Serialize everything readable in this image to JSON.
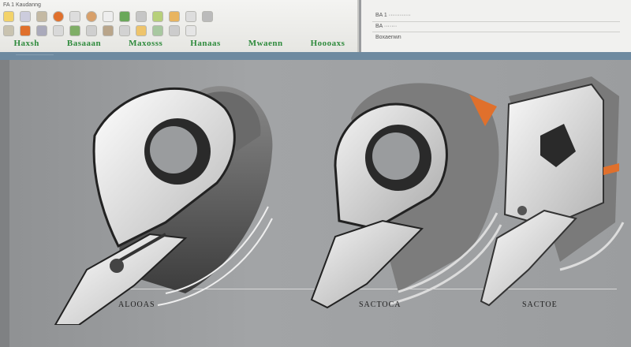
{
  "app": {
    "ribbon_title": "FA 1 Kaudanng",
    "group_labels": [
      "Haxsh",
      "Basaaan",
      "Maxosss",
      "Hanaas",
      "Mwaenn",
      "Hoooaxs"
    ]
  },
  "side_panel": {
    "line1": "BA 1 ············",
    "line2": "BA ·······",
    "line3": "Boxaenwn"
  },
  "tabstrip": {
    "tab_text": "························"
  },
  "colors": {
    "accent_orange": "#e0702c",
    "label_green": "#2e8a3c",
    "tab_blue": "#6e8aa0"
  },
  "icons": [
    "sun-icon",
    "crop-icon",
    "orange-circle-icon",
    "leaf-icon",
    "gear-icon",
    "puzzle-icon",
    "cursor-icon"
  ],
  "parts": [
    {
      "caption": "ALOOAS"
    },
    {
      "caption": "SACTOCA"
    },
    {
      "caption": "SACTOE"
    }
  ]
}
